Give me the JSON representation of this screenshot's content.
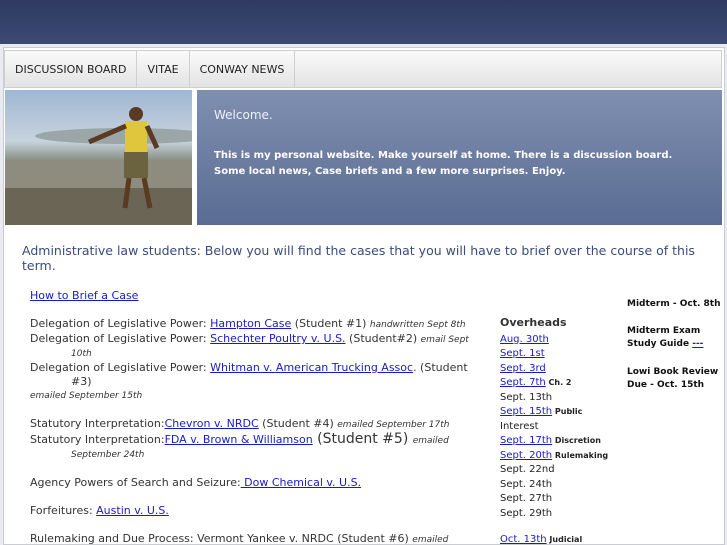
{
  "nav": {
    "items": [
      "DISCUSSION BOARD",
      "VITAE",
      "CONWAY NEWS"
    ]
  },
  "banner": {
    "welcome": "Welcome.",
    "intro": "This is my personal website.  Make yourself at home.  There is a discussion board.  Some local news, Case briefs and a few more surprises.   Enjoy."
  },
  "headline": "Administrative law students: Below you will find the cases that you will have to brief over the course of this term.",
  "main": {
    "how_to": "How to Brief a Case",
    "delegation": {
      "prefix": "Delegation of Legislative Power: ",
      "c1": "Hampton Case",
      "c1_after": " (Student #1) ",
      "c1_note": "handwritten Sept 8th",
      "c2": "Schechter Poultry v. U.S.",
      "c2_after": " (Student#2) ",
      "c2_note": "email Sept",
      "c2_note2": "10th",
      "c3": "Whitman v. American Trucking Assoc",
      "c3_after": ". (Student",
      "c3_cont": "#3)",
      "c3_note": "emailed September 15th"
    },
    "statutory": {
      "prefix": "Statutory Interpretation:",
      "c4": "Chevron v. NRDC",
      "c4_after": " (Student #4) ",
      "c4_note": "emailed September 17th",
      "c5": "FDA v. Brown & Williamson",
      "c5_after": " (Student #5) ",
      "c5_note": "emailed",
      "c5_note2": "September 24th"
    },
    "search": {
      "prefix": "Agency Powers of Search and Seizure:",
      "case": " Dow Chemical v. U.S."
    },
    "forfeitures": {
      "prefix": "Forfeitures: ",
      "case": "Austin v. U.S."
    },
    "rulemaking": {
      "text": "Rulemaking and Due Process: Vermont Yankee v. NRDC (Student #6) ",
      "note": "emailed"
    }
  },
  "overheads": {
    "title": "Overheads",
    "items": [
      {
        "label": "Aug. 30th",
        "link": true,
        "note": ""
      },
      {
        "label": "Sept. 1st",
        "link": true,
        "note": ""
      },
      {
        "label": "Sept. 3rd",
        "link": true,
        "note": ""
      },
      {
        "label": "Sept. 7th",
        "link": true,
        "note": " Ch. 2"
      },
      {
        "label": "Sept. 13th",
        "link": false,
        "note": ""
      },
      {
        "label": "Sept. 15th",
        "link": true,
        "note": " Public"
      },
      {
        "label": "Interest",
        "link": false,
        "note": ""
      },
      {
        "label": "Sept. 17th",
        "link": true,
        "note": " Discretion"
      },
      {
        "label": "Sept. 20th",
        "link": true,
        "note": " Rulemaking"
      },
      {
        "label": "Sept. 22nd",
        "link": false,
        "note": ""
      },
      {
        "label": "Sept. 24th",
        "link": false,
        "note": ""
      },
      {
        "label": "Sept. 27th",
        "link": false,
        "note": ""
      },
      {
        "label": "Sept. 29th",
        "link": false,
        "note": ""
      }
    ],
    "last": "Oct. 13th",
    "last_note": " Judicial"
  },
  "side": {
    "midterm": "Midterm - Oct. 8th",
    "guide": "Midterm Exam Study Guide",
    "guide_link": "---",
    "lowi": "Lowi Book Review Due - Oct. 15th"
  },
  "colors": {
    "topbar": "#2e3a60",
    "banner": "#6a7ba0",
    "link": "#1a1acc",
    "headline": "#3b4c7a"
  }
}
